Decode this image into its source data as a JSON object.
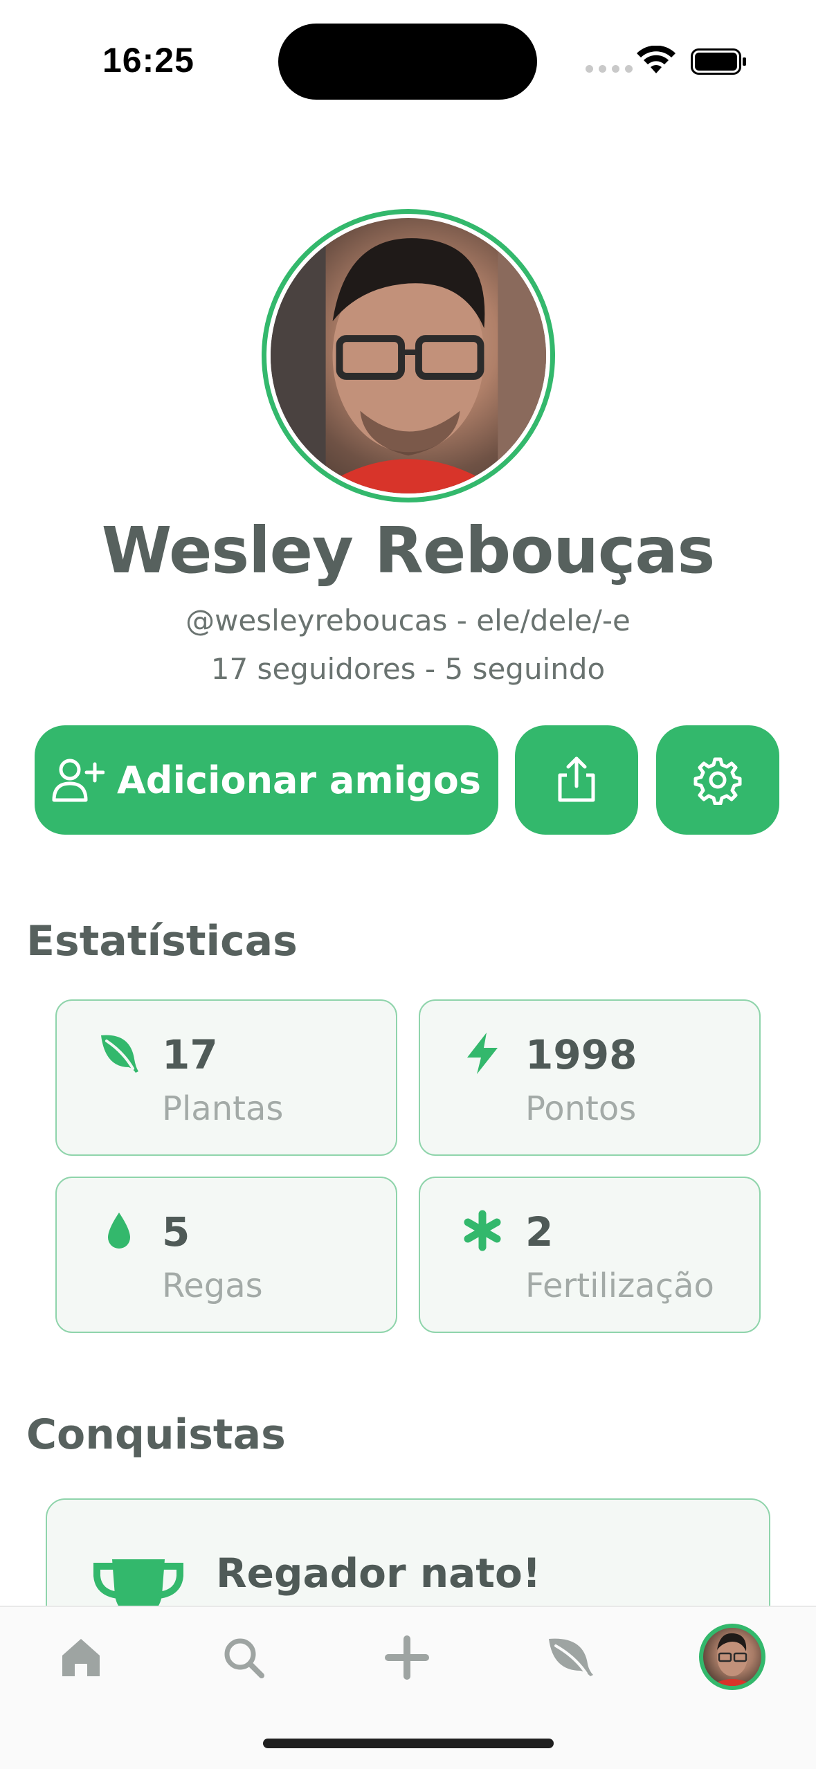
{
  "status_bar": {
    "time": "16:25"
  },
  "profile": {
    "name": "Wesley Rebouças",
    "handle": "@wesleyreboucas - ele/dele/-e",
    "follow_info": "17 seguidores - 5 seguindo"
  },
  "actions": {
    "add_friends_label": "Adicionar amigos"
  },
  "stats": {
    "title": "Estatísticas",
    "items": [
      {
        "value": "17",
        "label": "Plantas",
        "icon": "leaf-icon"
      },
      {
        "value": "1998",
        "label": "Pontos",
        "icon": "lightning-icon"
      },
      {
        "value": "5",
        "label": "Regas",
        "icon": "water-drop-icon"
      },
      {
        "value": "2",
        "label": "Fertilização",
        "icon": "asterisk-icon"
      }
    ]
  },
  "achievements": {
    "title": "Conquistas",
    "items": [
      {
        "name": "Regador nato!",
        "icon": "trophy-icon"
      }
    ]
  },
  "tabbar": [
    "home-icon",
    "search-icon",
    "plus-icon",
    "leaf-icon",
    "profile-avatar"
  ],
  "colors": {
    "accent": "#33b86c",
    "text": "#57615e",
    "muted": "#a3aaa7",
    "card_bg": "#f4f8f5"
  }
}
